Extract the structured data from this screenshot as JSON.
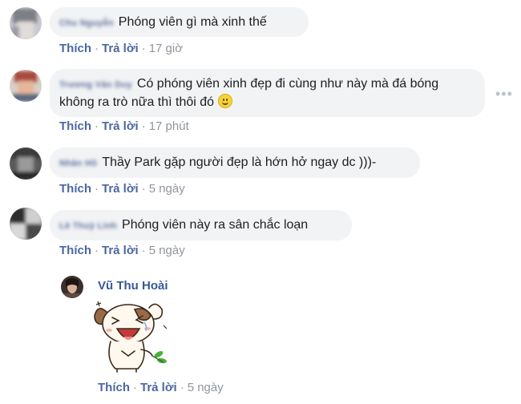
{
  "comments": [
    {
      "name_blurred": "Chu Nguyễn",
      "text": "Phóng viên gì mà xinh thế",
      "actions": {
        "like": "Thích",
        "reply": "Trả lời",
        "time": "17 giờ"
      }
    },
    {
      "name_blurred": "Trương Văn Duy",
      "text": "Có phóng viên xinh đẹp đi cùng như này mà đá bóng không ra trò nữa thì thôi đó",
      "more": "•••",
      "actions": {
        "like": "Thích",
        "reply": "Trả lời",
        "time": "17 phút"
      }
    },
    {
      "name_blurred": "Nhân Hồ",
      "text": "Thầy Park gặp người đẹp là hớn hở ngay dc )))-",
      "actions": {
        "like": "Thích",
        "reply": "Trả lời",
        "time": "5 ngày"
      }
    },
    {
      "name_blurred": "Lê Thuỳ Linh",
      "text": "Phóng viên này ra sân chắc loạn",
      "actions": {
        "like": "Thích",
        "reply": "Trả lời",
        "time": "5 ngày"
      }
    }
  ],
  "reply": {
    "name": "Vũ Thu Hoài",
    "actions": {
      "like": "Thích",
      "reply": "Trả lời",
      "time": "5 ngày"
    }
  },
  "separator": "·"
}
